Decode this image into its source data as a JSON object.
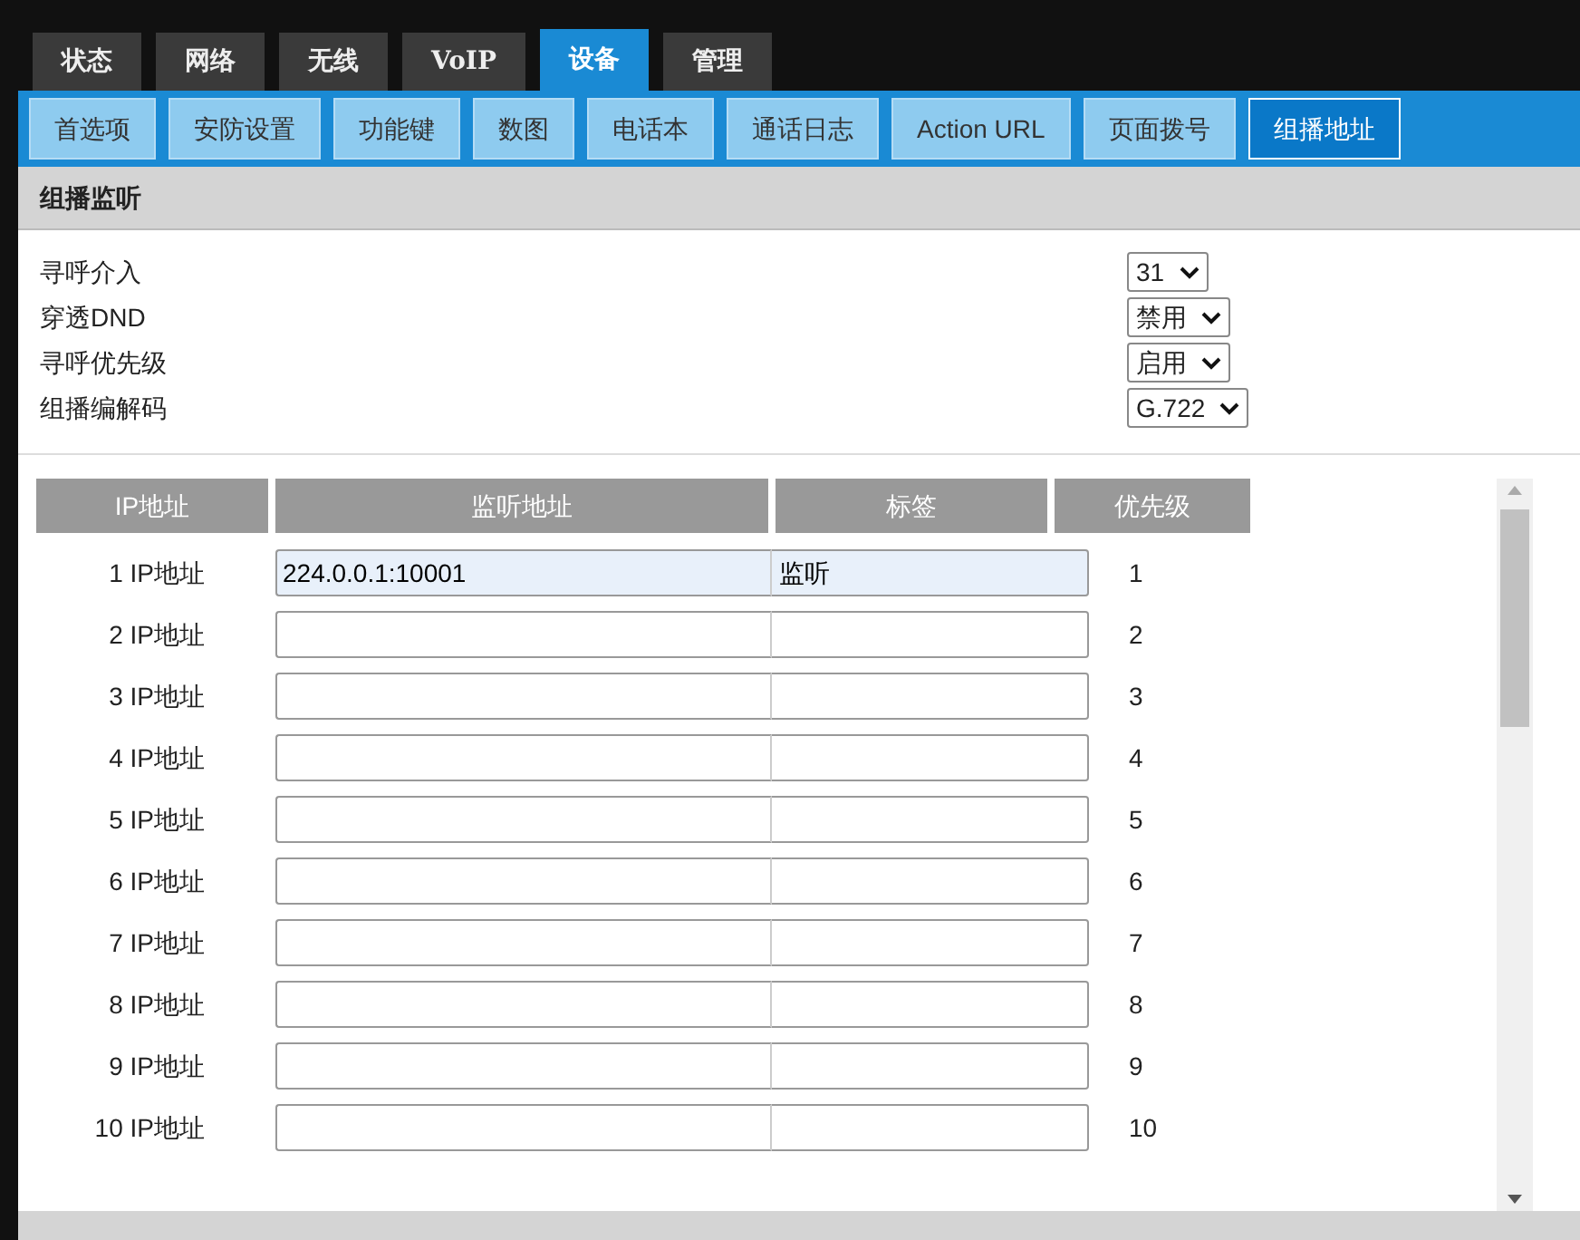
{
  "top_tabs": [
    {
      "label": "状态",
      "selected": false
    },
    {
      "label": "网络",
      "selected": false
    },
    {
      "label": "无线",
      "selected": false
    },
    {
      "label": "VoIP",
      "selected": false
    },
    {
      "label": "设备",
      "selected": true
    },
    {
      "label": "管理",
      "selected": false
    }
  ],
  "sub_tabs": [
    {
      "label": "首选项",
      "selected": false
    },
    {
      "label": "安防设置",
      "selected": false
    },
    {
      "label": "功能键",
      "selected": false
    },
    {
      "label": "数图",
      "selected": false
    },
    {
      "label": "电话本",
      "selected": false
    },
    {
      "label": "通话日志",
      "selected": false
    },
    {
      "label": "Action URL",
      "selected": false
    },
    {
      "label": "页面拨号",
      "selected": false
    },
    {
      "label": "组播地址",
      "selected": true
    }
  ],
  "section_title": "组播监听",
  "settings": [
    {
      "label": "寻呼介入",
      "value": "31"
    },
    {
      "label": "穿透DND",
      "value": "禁用"
    },
    {
      "label": "寻呼优先级",
      "value": "启用"
    },
    {
      "label": "组播编解码",
      "value": "G.722"
    }
  ],
  "table": {
    "columns": [
      "IP地址",
      "监听地址",
      "标签",
      "优先级"
    ],
    "rows": [
      {
        "label": "1 IP地址",
        "address": "224.0.0.1:10001",
        "tag": "监听",
        "priority": "1"
      },
      {
        "label": "2 IP地址",
        "priority": "2"
      },
      {
        "label": "3 IP地址",
        "priority": "3"
      },
      {
        "label": "4 IP地址",
        "priority": "4"
      },
      {
        "label": "5 IP地址",
        "priority": "5"
      },
      {
        "label": "6 IP地址",
        "priority": "6"
      },
      {
        "label": "7 IP地址",
        "priority": "7"
      },
      {
        "label": "8 IP地址",
        "priority": "8"
      },
      {
        "label": "9 IP地址",
        "priority": "9"
      },
      {
        "label": "10 IP地址",
        "priority": "10"
      }
    ]
  }
}
